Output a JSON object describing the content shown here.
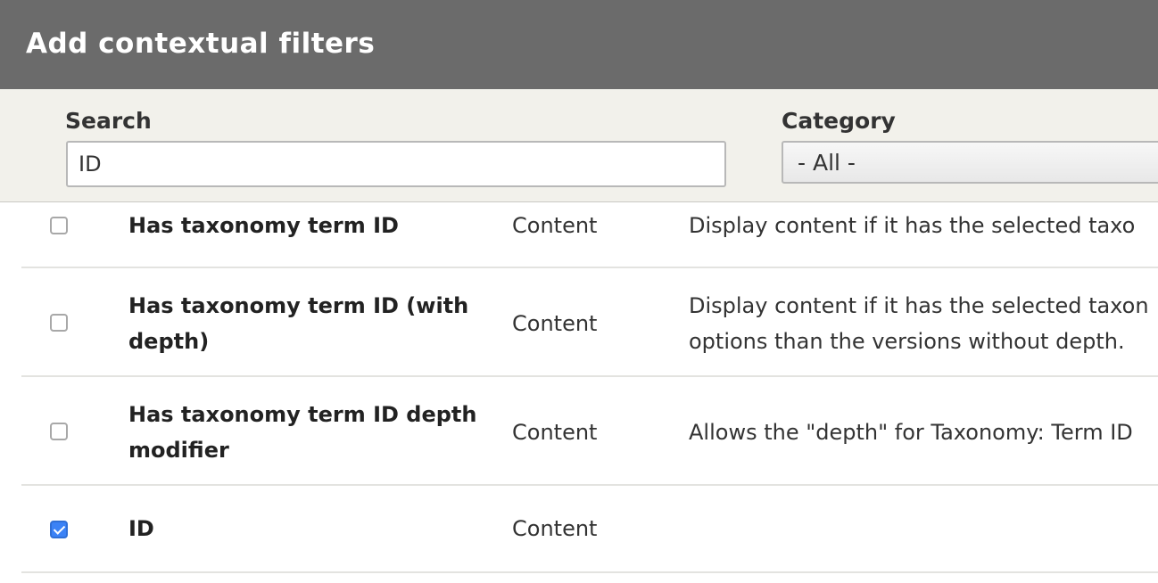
{
  "dialog": {
    "title": "Add contextual filters"
  },
  "filters": {
    "search_label": "Search",
    "search_value": "ID",
    "category_label": "Category",
    "category_value": "- All -"
  },
  "rows": [
    {
      "checked": false,
      "name": "Has taxonomy term ID",
      "category": "Content",
      "description_lines": [
        "Display content if it has the selected taxo"
      ]
    },
    {
      "checked": false,
      "name": "Has taxonomy term ID (with depth)",
      "category": "Content",
      "description_lines": [
        "Display content if it has the selected taxon",
        "options than the versions without depth."
      ]
    },
    {
      "checked": false,
      "name": "Has taxonomy term ID depth modifier",
      "category": "Content",
      "description_lines": [
        "Allows the \"depth\" for Taxonomy: Term ID"
      ]
    },
    {
      "checked": true,
      "name": "ID",
      "category": "Content",
      "description_lines": []
    }
  ],
  "colors": {
    "titlebar": "#6b6b6b",
    "filterbar": "#f2f1eb",
    "checkbox_checked": "#3b82f6"
  }
}
